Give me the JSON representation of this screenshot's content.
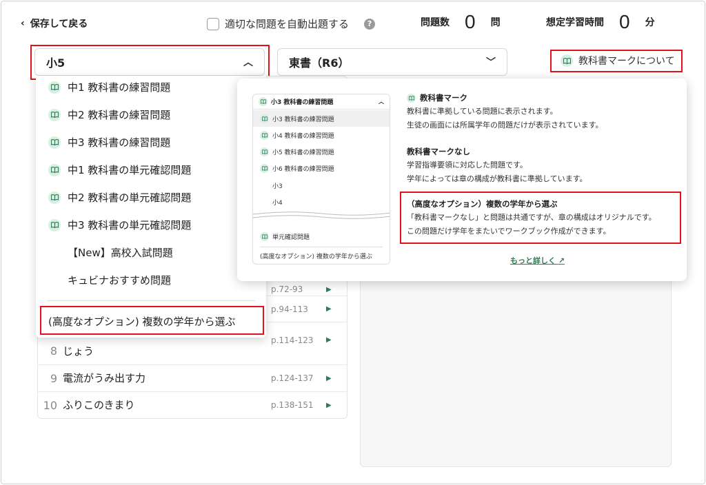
{
  "header": {
    "back_label": "保存して戻る",
    "auto_label": "適切な問題を自動出題する",
    "help_glyph": "?",
    "count_label": "問題数",
    "count_value": "0",
    "count_unit": "問",
    "time_label": "想定学習時間",
    "time_value": "0",
    "time_unit": "分"
  },
  "grade_select": {
    "value": "小5"
  },
  "publisher_select": {
    "value": "東書（R6）"
  },
  "mark_link": {
    "label": "教科書マークについて"
  },
  "dropdown": {
    "items": [
      {
        "label": "中1 教科書の練習問題",
        "book": true
      },
      {
        "label": "中2 教科書の練習問題",
        "book": true
      },
      {
        "label": "中3 教科書の練習問題",
        "book": true
      },
      {
        "label": "中1 教科書の単元確認問題",
        "book": true
      },
      {
        "label": "中2 教科書の単元確認問題",
        "book": true
      },
      {
        "label": "中3 教科書の単元確認問題",
        "book": true
      },
      {
        "label": "【New】高校入試問題",
        "book": false
      },
      {
        "label": "キュビナおすすめ問題",
        "book": false
      }
    ],
    "advanced_label": "(高度なオプション) 複数の学年から選ぶ"
  },
  "chapters": [
    {
      "num": "",
      "title": "",
      "pages": "p.72-93"
    },
    {
      "num": "",
      "title": "",
      "pages": "p.94-113"
    },
    {
      "num": "8",
      "title": "じょう",
      "pages": "p.114-123"
    },
    {
      "num": "9",
      "title": "電流がうみ出す力",
      "pages": "p.124-137"
    },
    {
      "num": "10",
      "title": "ふりこのきまり",
      "pages": "p.138-151"
    }
  ],
  "play_glyph": "▶",
  "popover": {
    "mini": {
      "head": "小3 教科書の練習問題",
      "items": [
        {
          "label": "小3 教科書の練習問題",
          "book": true
        },
        {
          "label": "小4 教科書の練習問題",
          "book": true
        },
        {
          "label": "小5 教科書の練習問題",
          "book": true
        },
        {
          "label": "小6 教科書の練習問題",
          "book": true
        },
        {
          "label": "小3",
          "book": false
        },
        {
          "label": "小4",
          "book": false
        }
      ],
      "unit_check": "単元確認問題",
      "advanced": "(高度なオプション) 複数の学年から選ぶ"
    },
    "sec1": {
      "title": "教科書マーク",
      "line1": "教科書に準拠している問題に表示されます。",
      "line2": "生徒の画面には所属学年の問題だけが表示されています。"
    },
    "sec2": {
      "title": "教科書マークなし",
      "line1": "学習指導要領に対応した問題です。",
      "line2": "学年によっては章の構成が教科書に準拠しています。"
    },
    "sec3": {
      "title": "（高度なオプション）複数の学年から選ぶ",
      "line1": "「教科書マークなし」と問題は共通ですが、章の構成はオリジナルです。",
      "line2": "この問題だけ学年をまたいでワークブック作成ができます。"
    },
    "more_label": "もっと詳しく"
  },
  "colors": {
    "accent_green": "#2e7d52",
    "highlight_red": "#e0111b",
    "book_bg": "#d8efe3"
  }
}
